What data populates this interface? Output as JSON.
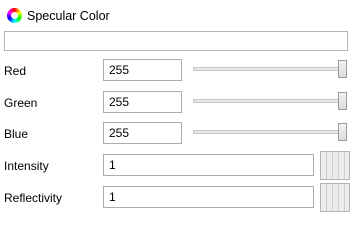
{
  "header": {
    "title": "Specular Color",
    "icon": "color-wheel-icon"
  },
  "swatch": {
    "color": "#ffffff"
  },
  "rows": {
    "red": {
      "label": "Red",
      "value": "255",
      "slider_fraction": 1.0
    },
    "green": {
      "label": "Green",
      "value": "255",
      "slider_fraction": 1.0
    },
    "blue": {
      "label": "Blue",
      "value": "255",
      "slider_fraction": 1.0
    },
    "intensity": {
      "label": "Intensity",
      "value": "1",
      "button_icon": "texture-picker-icon"
    },
    "reflectivity": {
      "label": "Reflectivity",
      "value": "1",
      "button_icon": "texture-picker-icon"
    }
  }
}
